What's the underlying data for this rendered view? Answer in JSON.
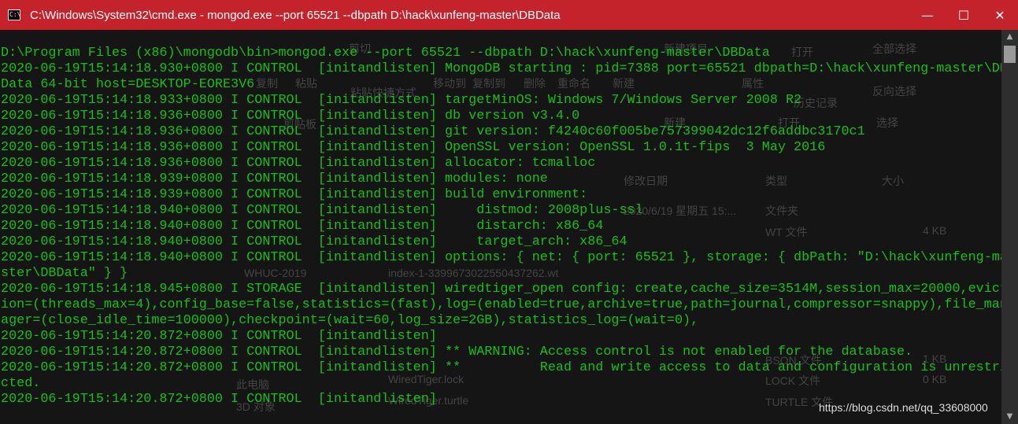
{
  "window": {
    "title": "C:\\Windows\\System32\\cmd.exe - mongod.exe  --port 65521 --dbpath D:\\hack\\xunfeng-master\\DBData",
    "icon_label": "C:\\",
    "buttons": {
      "minimize": "—",
      "maximize": "☐",
      "close": "✕"
    }
  },
  "console": {
    "lines": [
      "D:\\Program Files (x86)\\mongodb\\bin>mongod.exe --port 65521 --dbpath D:\\hack\\xunfeng-master\\DBData",
      "2020-06-19T15:14:18.930+0800 I CONTROL  [initandlisten] MongoDB starting : pid=7388 port=65521 dbpath=D:\\hack\\xunfeng-master\\DB",
      "Data 64-bit host=DESKTOP-EORE3V6",
      "2020-06-19T15:14:18.933+0800 I CONTROL  [initandlisten] targetMinOS: Windows 7/Windows Server 2008 R2",
      "2020-06-19T15:14:18.936+0800 I CONTROL  [initandlisten] db version v3.4.0",
      "2020-06-19T15:14:18.936+0800 I CONTROL  [initandlisten] git version: f4240c60f005be757399042dc12f6addbc3170c1",
      "2020-06-19T15:14:18.936+0800 I CONTROL  [initandlisten] OpenSSL version: OpenSSL 1.0.1t-fips  3 May 2016",
      "2020-06-19T15:14:18.936+0800 I CONTROL  [initandlisten] allocator: tcmalloc",
      "2020-06-19T15:14:18.939+0800 I CONTROL  [initandlisten] modules: none",
      "2020-06-19T15:14:18.939+0800 I CONTROL  [initandlisten] build environment:",
      "2020-06-19T15:14:18.940+0800 I CONTROL  [initandlisten]     distmod: 2008plus-ssl",
      "2020-06-19T15:14:18.940+0800 I CONTROL  [initandlisten]     distarch: x86_64",
      "2020-06-19T15:14:18.940+0800 I CONTROL  [initandlisten]     target_arch: x86_64",
      "2020-06-19T15:14:18.940+0800 I CONTROL  [initandlisten] options: { net: { port: 65521 }, storage: { dbPath: \"D:\\hack\\xunfeng-ma",
      "ster\\DBData\" } }",
      "2020-06-19T15:14:18.945+0800 I STORAGE  [initandlisten] wiredtiger_open config: create,cache_size=3514M,session_max=20000,evict",
      "ion=(threads_max=4),config_base=false,statistics=(fast),log=(enabled=true,archive=true,path=journal,compressor=snappy),file_man",
      "ager=(close_idle_time=100000),checkpoint=(wait=60,log_size=2GB),statistics_log=(wait=0),",
      "2020-06-19T15:14:20.872+0800 I CONTROL  [initandlisten]",
      "2020-06-19T15:14:20.872+0800 I CONTROL  [initandlisten] ** WARNING: Access control is not enabled for the database.",
      "2020-06-19T15:14:20.872+0800 I CONTROL  [initandlisten] **          Read and write access to data and configuration is unrestri",
      "cted.",
      "2020-06-19T15:14:20.872+0800 I CONTROL  [initandlisten]"
    ],
    "text_color": "#13c013",
    "background_color": "#151515"
  },
  "background_window": {
    "items": [
      "剪切",
      "新建项目",
      "打开",
      "全部选择",
      "复制",
      "粘贴",
      "粘贴快捷方式",
      "移动到",
      "复制到",
      "删除",
      "重命名",
      "新建",
      "属性",
      "历史记录",
      "反向选择",
      "剪贴板",
      "新建",
      "打开",
      "选择",
      "修改日期",
      "类型",
      "大小",
      "2020/6/19 星期五 15:...",
      "文件夹",
      "WT 文件",
      "4 KB",
      "index-1-3399673022550437262.wt",
      "WHUC-2019",
      "BSON 文件",
      "1 KB",
      "WiredTiger.lock",
      "LOCK 文件",
      "0 KB",
      "WiredTiger.turtle",
      "TURTLE 文件",
      "此电脑",
      "3D 对象"
    ]
  },
  "watermark": "https://blog.csdn.net/qq_33608000"
}
